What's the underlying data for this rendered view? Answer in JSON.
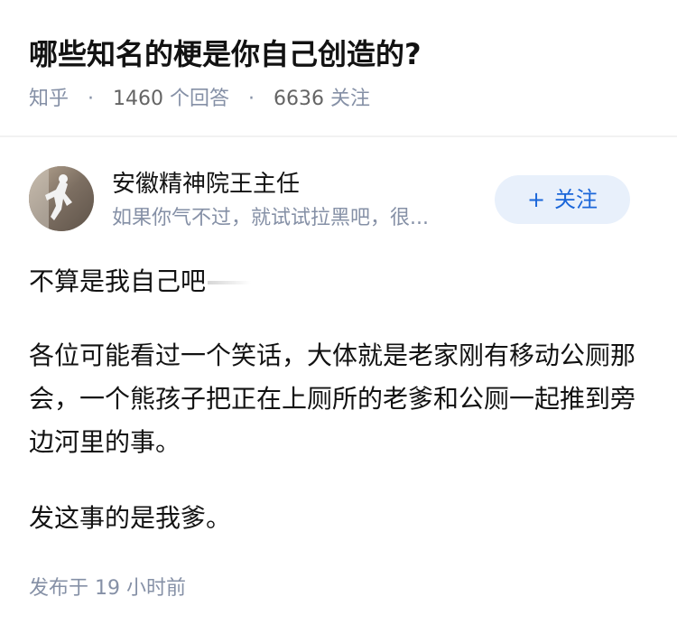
{
  "question": {
    "title": "哪些知名的梗是你自己创造的?",
    "meta": {
      "source": "知乎",
      "separator": "·",
      "answer_count": "1460",
      "answer_label": "个回答",
      "follower_count": "6636",
      "follower_label": "关注"
    }
  },
  "answer": {
    "author": {
      "name": "安徽精神院王主任",
      "bio": "如果你气不过，就试试拉黑吧，很..."
    },
    "follow_button": {
      "icon": "+",
      "label": "关注"
    },
    "paragraphs": [
      "不算是我自己吧",
      "各位可能看过一个笑话，大体就是老家刚有移动公厕那会，一个熊孩子把正在上厕所的老爹和公厕一起推到旁边河里的事。",
      "发这事的是我爹。"
    ],
    "publish": {
      "label": "发布于",
      "time": "19 小时前"
    }
  },
  "colors": {
    "text_primary": "#121212",
    "text_secondary": "#8590a6",
    "follow_button_bg": "#e8f0fb",
    "follow_button_text": "#1a66d9",
    "divider": "#f2f2f2"
  }
}
